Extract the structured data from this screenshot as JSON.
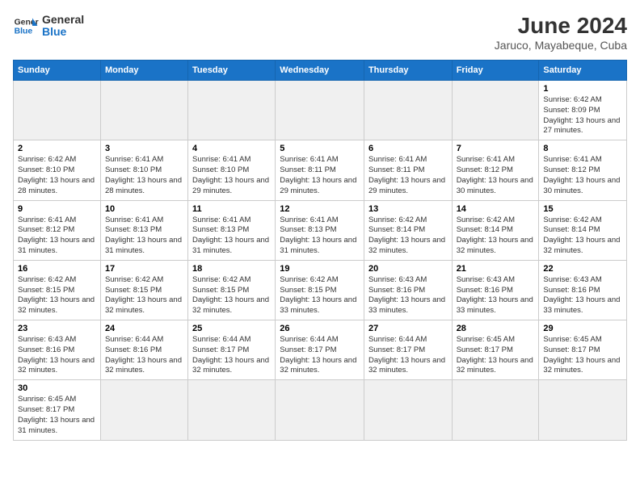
{
  "logo": {
    "text_general": "General",
    "text_blue": "Blue"
  },
  "title": "June 2024",
  "subtitle": "Jaruco, Mayabeque, Cuba",
  "days_of_week": [
    "Sunday",
    "Monday",
    "Tuesday",
    "Wednesday",
    "Thursday",
    "Friday",
    "Saturday"
  ],
  "weeks": [
    [
      {
        "num": "",
        "info": "",
        "empty": true
      },
      {
        "num": "",
        "info": "",
        "empty": true
      },
      {
        "num": "",
        "info": "",
        "empty": true
      },
      {
        "num": "",
        "info": "",
        "empty": true
      },
      {
        "num": "",
        "info": "",
        "empty": true
      },
      {
        "num": "",
        "info": "",
        "empty": true
      },
      {
        "num": "1",
        "info": "Sunrise: 6:42 AM\nSunset: 8:09 PM\nDaylight: 13 hours and 27 minutes."
      }
    ],
    [
      {
        "num": "2",
        "info": "Sunrise: 6:42 AM\nSunset: 8:10 PM\nDaylight: 13 hours and 28 minutes."
      },
      {
        "num": "3",
        "info": "Sunrise: 6:41 AM\nSunset: 8:10 PM\nDaylight: 13 hours and 28 minutes."
      },
      {
        "num": "4",
        "info": "Sunrise: 6:41 AM\nSunset: 8:10 PM\nDaylight: 13 hours and 29 minutes."
      },
      {
        "num": "5",
        "info": "Sunrise: 6:41 AM\nSunset: 8:11 PM\nDaylight: 13 hours and 29 minutes."
      },
      {
        "num": "6",
        "info": "Sunrise: 6:41 AM\nSunset: 8:11 PM\nDaylight: 13 hours and 29 minutes."
      },
      {
        "num": "7",
        "info": "Sunrise: 6:41 AM\nSunset: 8:12 PM\nDaylight: 13 hours and 30 minutes."
      },
      {
        "num": "8",
        "info": "Sunrise: 6:41 AM\nSunset: 8:12 PM\nDaylight: 13 hours and 30 minutes."
      }
    ],
    [
      {
        "num": "9",
        "info": "Sunrise: 6:41 AM\nSunset: 8:12 PM\nDaylight: 13 hours and 31 minutes."
      },
      {
        "num": "10",
        "info": "Sunrise: 6:41 AM\nSunset: 8:13 PM\nDaylight: 13 hours and 31 minutes."
      },
      {
        "num": "11",
        "info": "Sunrise: 6:41 AM\nSunset: 8:13 PM\nDaylight: 13 hours and 31 minutes."
      },
      {
        "num": "12",
        "info": "Sunrise: 6:41 AM\nSunset: 8:13 PM\nDaylight: 13 hours and 31 minutes."
      },
      {
        "num": "13",
        "info": "Sunrise: 6:42 AM\nSunset: 8:14 PM\nDaylight: 13 hours and 32 minutes."
      },
      {
        "num": "14",
        "info": "Sunrise: 6:42 AM\nSunset: 8:14 PM\nDaylight: 13 hours and 32 minutes."
      },
      {
        "num": "15",
        "info": "Sunrise: 6:42 AM\nSunset: 8:14 PM\nDaylight: 13 hours and 32 minutes."
      }
    ],
    [
      {
        "num": "16",
        "info": "Sunrise: 6:42 AM\nSunset: 8:15 PM\nDaylight: 13 hours and 32 minutes."
      },
      {
        "num": "17",
        "info": "Sunrise: 6:42 AM\nSunset: 8:15 PM\nDaylight: 13 hours and 32 minutes."
      },
      {
        "num": "18",
        "info": "Sunrise: 6:42 AM\nSunset: 8:15 PM\nDaylight: 13 hours and 32 minutes."
      },
      {
        "num": "19",
        "info": "Sunrise: 6:42 AM\nSunset: 8:15 PM\nDaylight: 13 hours and 33 minutes."
      },
      {
        "num": "20",
        "info": "Sunrise: 6:43 AM\nSunset: 8:16 PM\nDaylight: 13 hours and 33 minutes."
      },
      {
        "num": "21",
        "info": "Sunrise: 6:43 AM\nSunset: 8:16 PM\nDaylight: 13 hours and 33 minutes."
      },
      {
        "num": "22",
        "info": "Sunrise: 6:43 AM\nSunset: 8:16 PM\nDaylight: 13 hours and 33 minutes."
      }
    ],
    [
      {
        "num": "23",
        "info": "Sunrise: 6:43 AM\nSunset: 8:16 PM\nDaylight: 13 hours and 32 minutes."
      },
      {
        "num": "24",
        "info": "Sunrise: 6:44 AM\nSunset: 8:16 PM\nDaylight: 13 hours and 32 minutes."
      },
      {
        "num": "25",
        "info": "Sunrise: 6:44 AM\nSunset: 8:17 PM\nDaylight: 13 hours and 32 minutes."
      },
      {
        "num": "26",
        "info": "Sunrise: 6:44 AM\nSunset: 8:17 PM\nDaylight: 13 hours and 32 minutes."
      },
      {
        "num": "27",
        "info": "Sunrise: 6:44 AM\nSunset: 8:17 PM\nDaylight: 13 hours and 32 minutes."
      },
      {
        "num": "28",
        "info": "Sunrise: 6:45 AM\nSunset: 8:17 PM\nDaylight: 13 hours and 32 minutes."
      },
      {
        "num": "29",
        "info": "Sunrise: 6:45 AM\nSunset: 8:17 PM\nDaylight: 13 hours and 32 minutes."
      }
    ],
    [
      {
        "num": "30",
        "info": "Sunrise: 6:45 AM\nSunset: 8:17 PM\nDaylight: 13 hours and 31 minutes."
      },
      {
        "num": "",
        "info": "",
        "empty": true
      },
      {
        "num": "",
        "info": "",
        "empty": true
      },
      {
        "num": "",
        "info": "",
        "empty": true
      },
      {
        "num": "",
        "info": "",
        "empty": true
      },
      {
        "num": "",
        "info": "",
        "empty": true
      },
      {
        "num": "",
        "info": "",
        "empty": true
      }
    ]
  ]
}
